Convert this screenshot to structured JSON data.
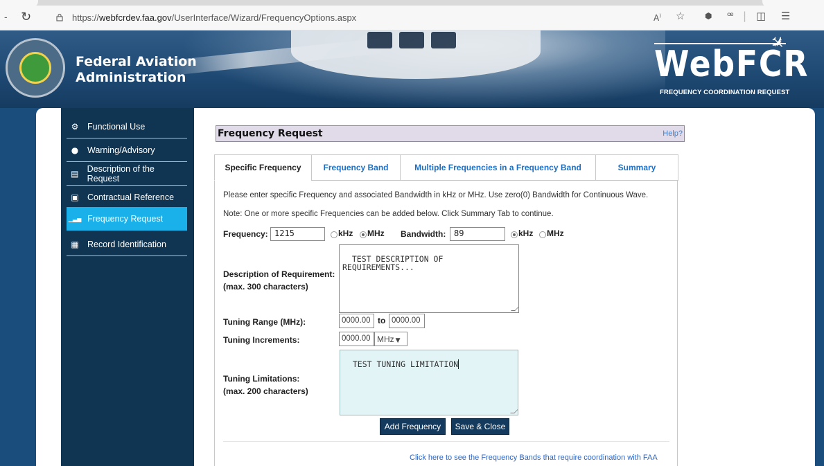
{
  "browser": {
    "url_prefix": "https://",
    "url_host": "webfcrdev.faa.gov",
    "url_path": "/UserInterface/Wizard/FrequencyOptions.aspx",
    "icons": [
      "reload-icon",
      "lock-icon",
      "read-aloud-icon",
      "favorite-star-icon",
      "extension-icon",
      "copilot-icon",
      "split-screen-icon",
      "favorites-icon"
    ]
  },
  "banner": {
    "org_line1": "Federal Aviation",
    "org_line2": "Administration",
    "logo_text": "WebFCR",
    "logo_subtitle": "FREQUENCY COORDINATION REQUEST"
  },
  "sidebar": {
    "items": [
      {
        "label": "Functional Use",
        "icon": "gears-icon",
        "glyph": "⚙"
      },
      {
        "label": "Warning/Advisory",
        "icon": "exclamation-icon",
        "glyph": "●"
      },
      {
        "label": "Description of the Request",
        "icon": "document-icon",
        "glyph": "▤"
      },
      {
        "label": "Contractual Reference",
        "icon": "contract-icon",
        "glyph": "▣"
      },
      {
        "label": "Frequency Request",
        "icon": "signal-bars-icon",
        "glyph": "▁▃▅",
        "active": true
      },
      {
        "label": "Record Identification",
        "icon": "record-icon",
        "glyph": "▦"
      }
    ]
  },
  "main": {
    "title": "Frequency Request",
    "help": "Help?",
    "tabs": [
      {
        "label": "Specific Frequency",
        "active": true
      },
      {
        "label": "Frequency Band"
      },
      {
        "label": "Multiple Frequencies in a Frequency Band"
      },
      {
        "label": "Summary"
      }
    ],
    "instruction": "Please enter specific Frequency and associated Bandwidth in kHz or MHz. Use zero(0) Bandwidth for Continuous Wave.",
    "note": "Note: One or more specific Frequencies can be added below. Click Summary Tab to continue.",
    "frequency": {
      "label": "Frequency:",
      "value": "1215",
      "unit_khz": "kHz",
      "unit_mhz": "MHz",
      "selected_unit": "MHz"
    },
    "bandwidth": {
      "label": "Bandwidth:",
      "value": "89",
      "unit_khz": "kHz",
      "unit_mhz": "MHz",
      "selected_unit": "kHz"
    },
    "description": {
      "label_line1": "Description of Requirement:",
      "label_line2": "(max. 300 characters)",
      "value": "TEST DESCRIPTION OF\nREQUIREMENTS..."
    },
    "tuning_range": {
      "label": "Tuning Range (MHz):",
      "from": "0000.00",
      "to_label": "to",
      "to": "0000.00"
    },
    "tuning_increments": {
      "label": "Tuning Increments:",
      "value": "0000.00",
      "unit": "MHz"
    },
    "tuning_limitations": {
      "label_line1": "Tuning Limitations:",
      "label_line2": "(max. 200 characters)",
      "value": "TEST TUNING LIMITATION"
    },
    "buttons": {
      "add": "Add Frequency",
      "save": "Save & Close"
    },
    "bottom_link": "Click here to see the Frequency Bands that require coordination with FAA"
  },
  "colors": {
    "banner": "#1f4a74",
    "sidebar": "#103552",
    "active_nav": "#1ab0ea",
    "tab_link": "#1c6fc5",
    "button": "#143a5e",
    "header_bg": "#e1dbe9",
    "tuning_bg": "#e3f4f7"
  }
}
